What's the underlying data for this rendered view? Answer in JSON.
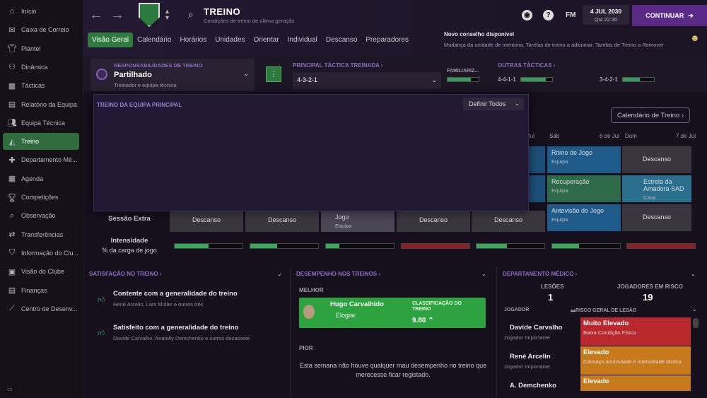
{
  "sidebar": {
    "items": [
      {
        "label": "Início",
        "icon": "home-icon"
      },
      {
        "label": "Caixa de Correio",
        "icon": "inbox-icon"
      },
      {
        "label": "Plantel",
        "icon": "shirt-icon"
      },
      {
        "label": "Dinâmica",
        "icon": "dynamics-icon"
      },
      {
        "label": "Tácticas",
        "icon": "tactics-icon"
      },
      {
        "label": "Relatório da Equipa",
        "icon": "report-icon"
      },
      {
        "label": "Equipa Técnica",
        "icon": "staff-icon"
      },
      {
        "label": "Treino",
        "icon": "training-icon"
      },
      {
        "label": "Departamento Mé...",
        "icon": "medical-icon"
      },
      {
        "label": "Agenda",
        "icon": "calendar-icon"
      },
      {
        "label": "Competições",
        "icon": "trophy-icon"
      },
      {
        "label": "Observação",
        "icon": "scouting-icon"
      },
      {
        "label": "Transferências",
        "icon": "transfers-icon"
      },
      {
        "label": "Informação do Clu...",
        "icon": "club-info-icon"
      },
      {
        "label": "Visão do Clube",
        "icon": "vision-icon"
      },
      {
        "label": "Finanças",
        "icon": "finances-icon"
      },
      {
        "label": "Centro de Desenv...",
        "icon": "development-icon"
      }
    ],
    "active_index": 7
  },
  "header": {
    "title": "TREINO",
    "subtitle": "Condições de treino de última geração",
    "fm": "FM",
    "date": "4 JUL 2030",
    "day_time": "Qui 22:30",
    "continue": "CONTINUAR",
    "tabs": [
      "Visão Geral",
      "Calendário",
      "Horários",
      "Unidades",
      "Orientar",
      "Individual",
      "Descanso",
      "Preparadores"
    ],
    "active_tab": 0,
    "notification": {
      "title": "Novo conselho disponível",
      "message": "Mudança da unidade de mentoria, Tarefas de treino a adicionar, Tarefas de Treino a Remover"
    }
  },
  "responsibilities": {
    "label": "RESPONSABILIDADES DE TREINO",
    "value": "Partilhado",
    "sub": "Treinador e equipa técnica"
  },
  "tactic": {
    "label": "PRINCIPAL TÁCTICA TREINADA",
    "value": "4-3-2-1",
    "familiarity_label": "FAMILIARIZ...",
    "familiarity": 0.75
  },
  "other_tactics": {
    "label": "OUTRAS TÁCTICAS",
    "items": [
      {
        "name": "4-4-1-1",
        "familiarity": 0.8
      },
      {
        "name": "3-4-2-1",
        "familiarity": 0.55
      }
    ]
  },
  "calendar_button": "Calendário de Treino",
  "days": [
    {
      "name": "",
      "date": "6 de Jul"
    },
    {
      "name": "Sáb",
      "date": "6 de Jul"
    },
    {
      "name": "Dom",
      "date": "7 de Jul"
    }
  ],
  "grid": {
    "sab": [
      {
        "t": "Ritmo de Jogo",
        "s": "Equipa"
      },
      {
        "t": "Recuperação",
        "s": "Equipa"
      },
      {
        "t": "Antevisão do Jogo",
        "s": "Equipa"
      }
    ],
    "dom": [
      {
        "t": "Descanso",
        "s": ""
      },
      {
        "t": "Estrela da Amadora SAD",
        "s": "Casa"
      },
      {
        "t": "Descanso",
        "s": ""
      }
    ],
    "extra_label": "Sessão Extra",
    "extra": [
      "Descanso",
      "Descanso",
      "Jogo",
      "Descanso",
      "Descanso"
    ],
    "extra_sub": "Equipa",
    "intensity_label": "Intensidade",
    "intensity_sub": "% da carga de jogo",
    "intensity": [
      0.5,
      0.4,
      0.2,
      0.0,
      0.45,
      0.4,
      0.0
    ]
  },
  "modal": {
    "title": "TREINO DA EQUIPA PRINCIPAL",
    "button": "Definir Todos"
  },
  "satisfaction": {
    "title": "SATISFAÇÃO NO TREINO",
    "items": [
      {
        "t": "Contente com a generalidade do treino",
        "s": "René Arcelin, Lars Müller e outros três"
      },
      {
        "t": "Satisfeito com a generalidade do treino",
        "s": "Davide Carvalho, Anatoliy Demchenko e outros dezassete"
      }
    ]
  },
  "performance": {
    "title": "DESEMPENHO NOS TREINOS",
    "best_label": "MELHOR",
    "best_name": "Hugo Carvalhido",
    "best_personality": "Elogiar",
    "rating_label": "CLASSIFICAÇÃO DO TREINO",
    "rating": "9.80",
    "worst_label": "PIOR",
    "worst_msg": "Esta semana não houve qualquer mau desempenho no treino que merecesse ficar registado."
  },
  "medical": {
    "title": "DEPARTAMENTO MÉDICO",
    "injuries_label": "LESÕES",
    "injuries": "1",
    "risk_label": "JOGADORES EM RISCO",
    "risk_count": "19",
    "col_player": "JOGADOR",
    "col_risk": "RISCO GERAL DE LESÃO",
    "players": [
      {
        "name": "Davide Carvalho",
        "role": "Jogador Importante",
        "risk": "Muito Elevado",
        "reason": "Baixa Condição Física",
        "color": "#b8282d"
      },
      {
        "name": "René Arcelin",
        "role": "Jogador Importante",
        "risk": "Elevado",
        "reason": "Cansaço acumulado e intensidade táctica",
        "color": "#c77a1c"
      },
      {
        "name": "A. Demchenko",
        "role": "",
        "risk": "Elevado",
        "reason": "",
        "color": "#c77a1c"
      }
    ]
  }
}
